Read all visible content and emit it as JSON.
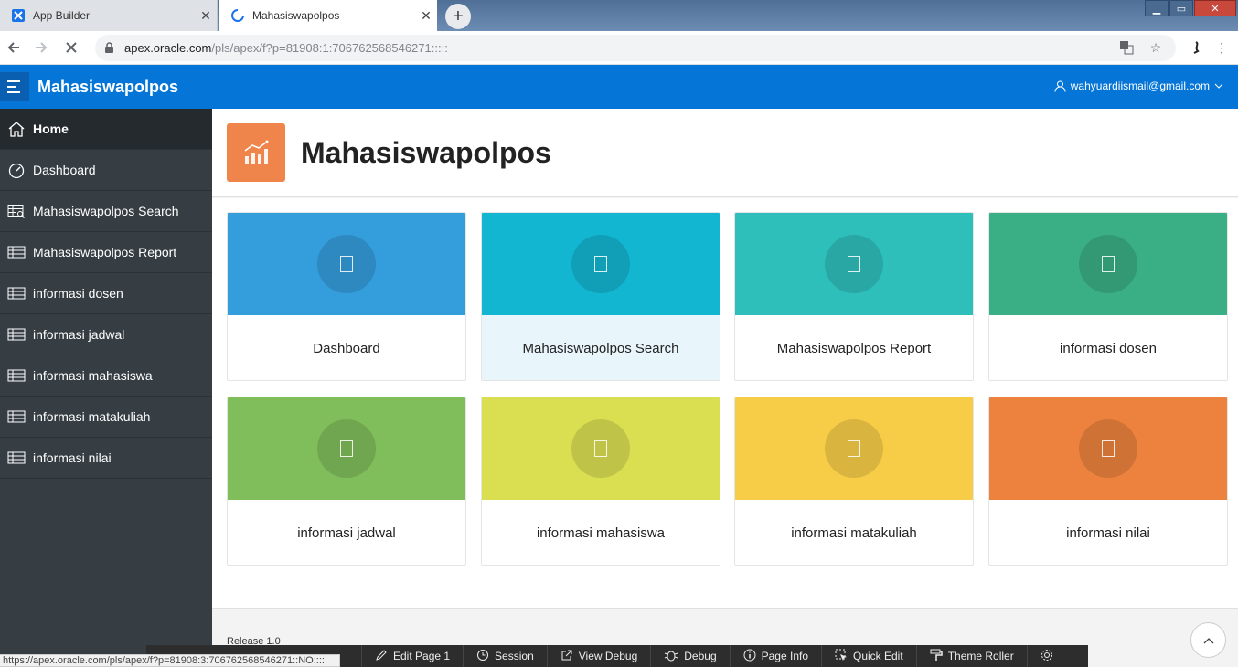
{
  "browser": {
    "tabs": [
      {
        "title": "App Builder",
        "icon": "apex-icon",
        "close": "✕"
      },
      {
        "title": "Mahasiswapolpos",
        "icon": "loading-spinner-icon",
        "close": "✕"
      }
    ],
    "new_tab": "+",
    "url_host": "apex.oracle.com",
    "url_path": "/pls/apex/f?p=81908:1:706762568546271:::::",
    "status_url": "https://apex.oracle.com/pls/apex/f?p=81908:3:706762568546271::NO::::"
  },
  "app": {
    "title": "Mahasiswapolpos",
    "user": "wahyuardiismail@gmail.com",
    "accent": "#0576d8"
  },
  "sidebar": {
    "items": [
      {
        "label": "Home",
        "icon": "home-icon",
        "active": true
      },
      {
        "label": "Dashboard",
        "icon": "dashboard-icon"
      },
      {
        "label": "Mahasiswapolpos Search",
        "icon": "table-search-icon"
      },
      {
        "label": "Mahasiswapolpos Report",
        "icon": "table-icon"
      },
      {
        "label": "informasi dosen",
        "icon": "table-icon"
      },
      {
        "label": "informasi jadwal",
        "icon": "table-icon"
      },
      {
        "label": "informasi mahasiswa",
        "icon": "table-icon"
      },
      {
        "label": "informasi matakuliah",
        "icon": "table-icon"
      },
      {
        "label": "informasi nilai",
        "icon": "table-icon"
      }
    ]
  },
  "page": {
    "title": "Mahasiswapolpos",
    "icon": "chart-icon",
    "release": "Release 1.0"
  },
  "cards": [
    {
      "label": "Dashboard",
      "color": "#349ddb"
    },
    {
      "label": "Mahasiswapolpos Search",
      "color": "#13b6d0"
    },
    {
      "label": "Mahasiswapolpos Report",
      "color": "#2ebfbb"
    },
    {
      "label": "informasi dosen",
      "color": "#3aaf85"
    },
    {
      "label": "informasi jadwal",
      "color": "#80bd5b"
    },
    {
      "label": "informasi mahasiswa",
      "color": "#dade51"
    },
    {
      "label": "informasi matakuliah",
      "color": "#f7cd48"
    },
    {
      "label": "informasi nilai",
      "color": "#ec823e"
    }
  ],
  "devbar": {
    "items": [
      {
        "label": "Edit Page 1",
        "icon": "edit-icon"
      },
      {
        "label": "Session",
        "icon": "clock-icon"
      },
      {
        "label": "View Debug",
        "icon": "external-link-icon"
      },
      {
        "label": "Debug",
        "icon": "bug-icon"
      },
      {
        "label": "Page Info",
        "icon": "info-icon"
      },
      {
        "label": "Quick Edit",
        "icon": "cursor-select-icon"
      },
      {
        "label": "Theme Roller",
        "icon": "paint-roller-icon"
      },
      {
        "label": "",
        "icon": "gear-icon"
      }
    ]
  }
}
